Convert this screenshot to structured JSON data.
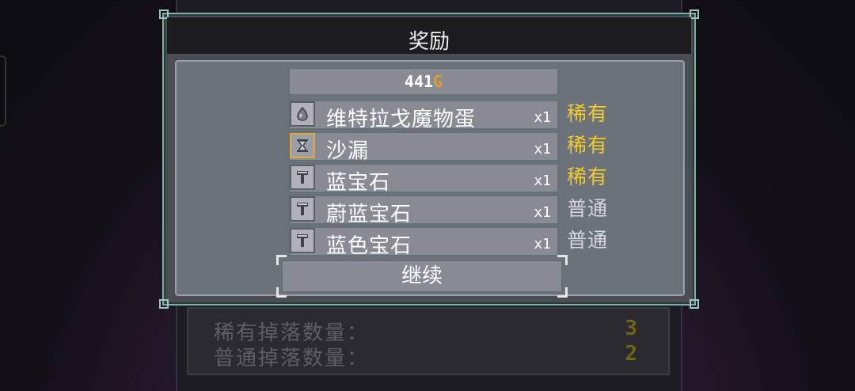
{
  "dialog": {
    "title": "奖励",
    "gold": {
      "amount": "441",
      "unit": "G"
    },
    "items": [
      {
        "name": "维特拉戈魔物蛋",
        "qty": "x1",
        "rarity": "稀有",
        "icon": "egg-icon",
        "rarity_type": "rare"
      },
      {
        "name": "沙漏",
        "qty": "x1",
        "rarity": "稀有",
        "icon": "hourglass-icon",
        "rarity_type": "rare"
      },
      {
        "name": "蓝宝石",
        "qty": "x1",
        "rarity": "稀有",
        "icon": "hammer-icon",
        "rarity_type": "rare"
      },
      {
        "name": "蔚蓝宝石",
        "qty": "x1",
        "rarity": "普通",
        "icon": "hammer-icon",
        "rarity_type": "common"
      },
      {
        "name": "蓝色宝石",
        "qty": "x1",
        "rarity": "普通",
        "icon": "hammer-icon",
        "rarity_type": "common"
      }
    ],
    "continue_label": "继续"
  },
  "background": {
    "stats": [
      {
        "label": "稀有掉落数量：",
        "value": "3"
      },
      {
        "label": "普通掉落数量：",
        "value": "2"
      }
    ]
  },
  "colors": {
    "rare": "#f3ca2c",
    "common": "#d6d8db",
    "gold_unit": "#e39a2c",
    "dialog_border": "#7fb0a5"
  }
}
